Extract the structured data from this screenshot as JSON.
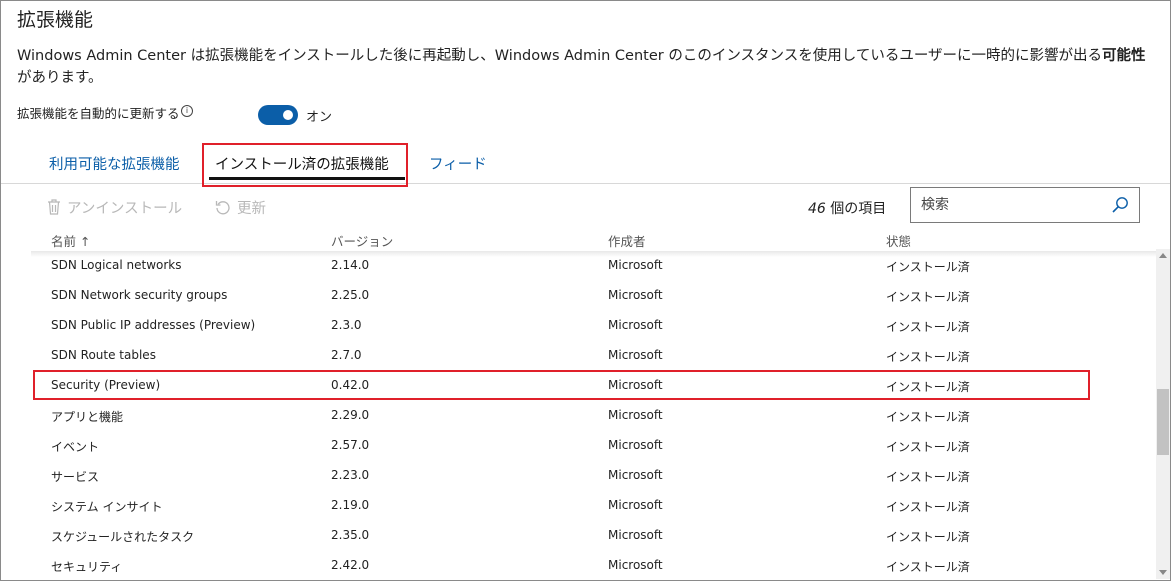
{
  "page": {
    "title": "拡張機能",
    "description_before": "Windows Admin Center は拡張機能をインストールした後に再起動し、Windows Admin Center のこのインスタンスを使用しているユーザーに一時的に影響が出る",
    "description_bold": "可能性",
    "description_after": "があります。"
  },
  "auto_update": {
    "label": "拡張機能を自動的に更新する",
    "info_symbol": "i",
    "toggle_state": "オン",
    "enabled": true
  },
  "tabs": [
    {
      "label": "利用可能な拡張機能",
      "active": false
    },
    {
      "label": "インストール済の拡張機能",
      "active": true
    },
    {
      "label": "フィード",
      "active": false
    }
  ],
  "toolbar": {
    "uninstall_label": "アンインストール",
    "uninstall_icon": "trash-icon",
    "refresh_label": "更新",
    "refresh_icon": "refresh-icon",
    "count_number": "46",
    "count_suffix": " 個の項目"
  },
  "search": {
    "placeholder": "検索",
    "value": "",
    "icon": "search-icon"
  },
  "table": {
    "headers": {
      "name": "名前",
      "sort_indicator": "↑",
      "version": "バージョン",
      "author": "作成者",
      "status": "状態"
    },
    "rows": [
      {
        "name": "SDN Logical networks",
        "version": "2.14.0",
        "author": "Microsoft",
        "status": "インストール済"
      },
      {
        "name": "SDN Network security groups",
        "version": "2.25.0",
        "author": "Microsoft",
        "status": "インストール済"
      },
      {
        "name": "SDN Public IP addresses (Preview)",
        "version": "2.3.0",
        "author": "Microsoft",
        "status": "インストール済"
      },
      {
        "name": "SDN Route tables",
        "version": "2.7.0",
        "author": "Microsoft",
        "status": "インストール済"
      },
      {
        "name": "Security (Preview)",
        "version": "0.42.0",
        "author": "Microsoft",
        "status": "インストール済"
      },
      {
        "name": "アプリと機能",
        "version": "2.29.0",
        "author": "Microsoft",
        "status": "インストール済"
      },
      {
        "name": "イベント",
        "version": "2.57.0",
        "author": "Microsoft",
        "status": "インストール済"
      },
      {
        "name": "サービス",
        "version": "2.23.0",
        "author": "Microsoft",
        "status": "インストール済"
      },
      {
        "name": "システム インサイト",
        "version": "2.19.0",
        "author": "Microsoft",
        "status": "インストール済"
      },
      {
        "name": "スケジュールされたタスク",
        "version": "2.35.0",
        "author": "Microsoft",
        "status": "インストール済"
      },
      {
        "name": "セキュリティ",
        "version": "2.42.0",
        "author": "Microsoft",
        "status": "インストール済"
      }
    ]
  },
  "colors": {
    "accent": "#0b5ea8",
    "highlight": "#e0202a",
    "disabled": "#b8b8b8"
  }
}
